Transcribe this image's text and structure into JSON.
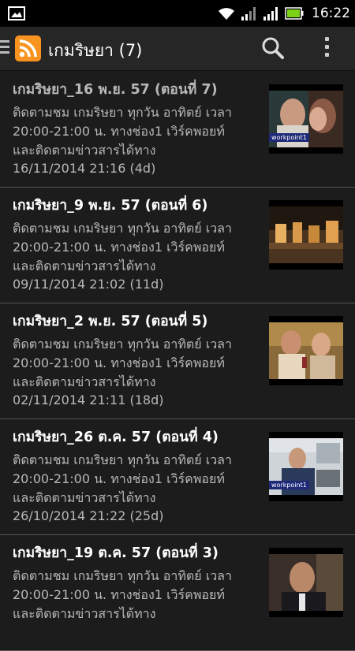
{
  "status_bar": {
    "time": "16:22",
    "icons": [
      "gallery-icon",
      "wifi-icon",
      "signal-icon",
      "signal-icon",
      "battery-icon"
    ]
  },
  "app_bar": {
    "title": "เกมริษยา (7)",
    "icons": [
      "drawer-icon",
      "rss-feed-icon",
      "search-icon",
      "overflow-menu-icon"
    ]
  },
  "feed": {
    "items": [
      {
        "title": "เกมริษยา_16 พ.ย. 57 (ตอนที่ 7)",
        "desc1": "ติดตามชม เกมริษยา ทุกวัน อาทิตย์ เวลา",
        "desc2": "20:00-21:00 น. ทางช่อง1 เวิร์คพอยท์",
        "desc3": "และติดตามข่าวสารได้ทาง",
        "date": "16/11/2014 21:16 (4d)",
        "badge": "workpoint1"
      },
      {
        "title": "เกมริษยา_9 พ.ย. 57 (ตอนที่ 6)",
        "desc1": "ติดตามชม เกมริษยา ทุกวัน อาทิตย์ เวลา",
        "desc2": "20:00-21:00 น. ทางช่อง1 เวิร์คพอยท์",
        "desc3": "และติดตามข่าวสารได้ทาง",
        "date": "09/11/2014 21:02 (11d)"
      },
      {
        "title": "เกมริษยา_2 พ.ย. 57 (ตอนที่ 5)",
        "desc1": "ติดตามชม เกมริษยา ทุกวัน อาทิตย์ เวลา",
        "desc2": "20:00-21:00 น. ทางช่อง1 เวิร์คพอยท์",
        "desc3": "และติดตามข่าวสารได้ทาง",
        "date": "02/11/2014 21:11 (18d)"
      },
      {
        "title": "เกมริษยา_26 ต.ค. 57 (ตอนที่ 4)",
        "desc1": "ติดตามชม เกมริษยา ทุกวัน อาทิตย์ เวลา",
        "desc2": "20:00-21:00 น. ทางช่อง1 เวิร์คพอยท์",
        "desc3": "และติดตามข่าวสารได้ทาง",
        "date": "26/10/2014 21:22 (25d)",
        "badge": "workpoint1"
      },
      {
        "title": "เกมริษยา_19 ต.ค. 57 (ตอนที่ 3)",
        "desc1": "ติดตามชม เกมริษยา ทุกวัน อาทิตย์ เวลา",
        "desc2": "20:00-21:00 น. ทางช่อง1 เวิร์คพอยท์",
        "desc3": "และติดตามข่าวสารได้ทาง",
        "date": ""
      }
    ]
  },
  "colors": {
    "background": "#1c1c1c",
    "action_bar": "#262626",
    "rss_orange": "#f7931e",
    "battery_green": "#7cd117",
    "read_text": "#b8b8b8",
    "unread_text": "#ffffff"
  }
}
